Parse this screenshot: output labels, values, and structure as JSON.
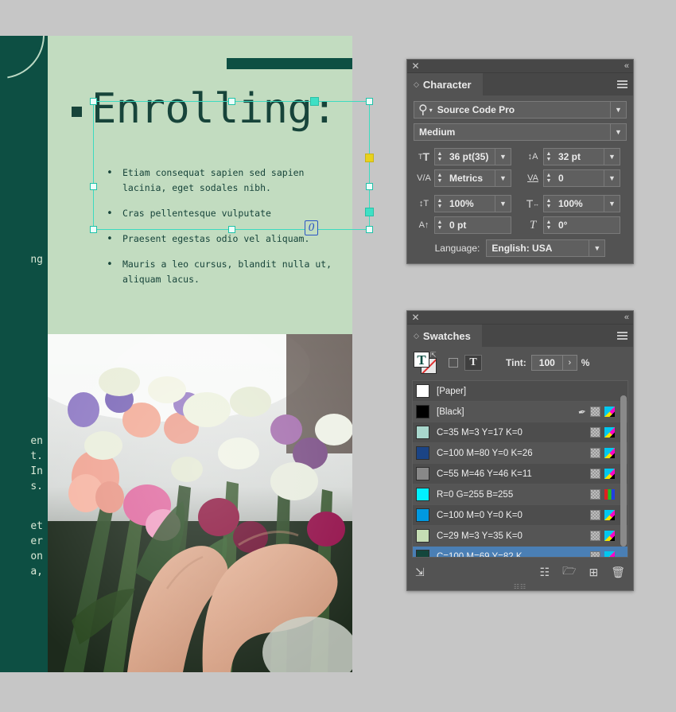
{
  "document": {
    "headline": "Enrolling:",
    "bullets": [
      "Etiam consequat sapien sed sapien lacinia, eget sodales nibh.",
      "Cras pellentesque vulputate",
      "Praesent egestas odio vel aliquam.",
      "Mauris a leo cursus, blandit nulla ut, aliquam lacus."
    ],
    "left_fragments": [
      "ng",
      "en\nt.\nIn\ns.",
      "et\ner\non\na,"
    ],
    "overflow_marker": "0",
    "colors": {
      "page_bg": "#c2dcc0",
      "dark_teal": "#0d4f43",
      "text_dark": "#17443a",
      "selection": "#3ddbc0",
      "handle_yellow": "#e8d21c"
    }
  },
  "character_panel": {
    "tab_label": "Character",
    "font_family": "Source Code Pro",
    "font_style": "Medium",
    "font_size": "36 pt(35)",
    "leading": "32 pt",
    "kerning": "Metrics",
    "tracking": "0",
    "vertical_scale": "100%",
    "horizontal_scale": "100%",
    "baseline_shift": "0 pt",
    "skew": "0°",
    "language_label": "Language:",
    "language_value": "English: USA",
    "icons": {
      "size": "font-size-icon",
      "leading": "leading-icon",
      "kerning": "kerning-icon",
      "tracking": "tracking-icon",
      "vscale": "vertical-scale-icon",
      "hscale": "horizontal-scale-icon",
      "baseline": "baseline-shift-icon",
      "skew": "skew-icon"
    }
  },
  "swatches_panel": {
    "tab_label": "Swatches",
    "tint_label": "Tint:",
    "tint_value": "100",
    "tint_unit": "%",
    "swatches": [
      {
        "name": "[Paper]",
        "color": "#ffffff",
        "icons": []
      },
      {
        "name": "[Black]",
        "color": "#000000",
        "icons": [
          "pen",
          "check",
          "cmyk"
        ]
      },
      {
        "name": "C=35 M=3 Y=17 K=0",
        "color": "#a9d7cd",
        "icons": [
          "check",
          "cmyk"
        ]
      },
      {
        "name": "C=100 M=80 Y=0 K=26",
        "color": "#1b4485",
        "icons": [
          "check",
          "cmyk"
        ]
      },
      {
        "name": "C=55 M=46 Y=46 K=11",
        "color": "#888888",
        "icons": [
          "check",
          "cmyk"
        ]
      },
      {
        "name": "R=0 G=255 B=255",
        "color": "#00f0ff",
        "icons": [
          "check",
          "rgb"
        ]
      },
      {
        "name": "C=100 M=0 Y=0 K=0",
        "color": "#0099e0",
        "icons": [
          "check",
          "cmyk"
        ]
      },
      {
        "name": "C=29 M=3 Y=35 K=0",
        "color": "#c5ddb4",
        "icons": [
          "check",
          "cmyk"
        ]
      },
      {
        "name": "C=100 M=69 Y=82 K...",
        "color": "#13463c",
        "icons": [
          "check",
          "cmyk"
        ],
        "selected": true
      }
    ],
    "bottom_icons": [
      "show-all-swatches-icon",
      "new-color-group-icon",
      "new-folder-icon",
      "new-swatch-icon",
      "delete-swatch-icon"
    ]
  }
}
